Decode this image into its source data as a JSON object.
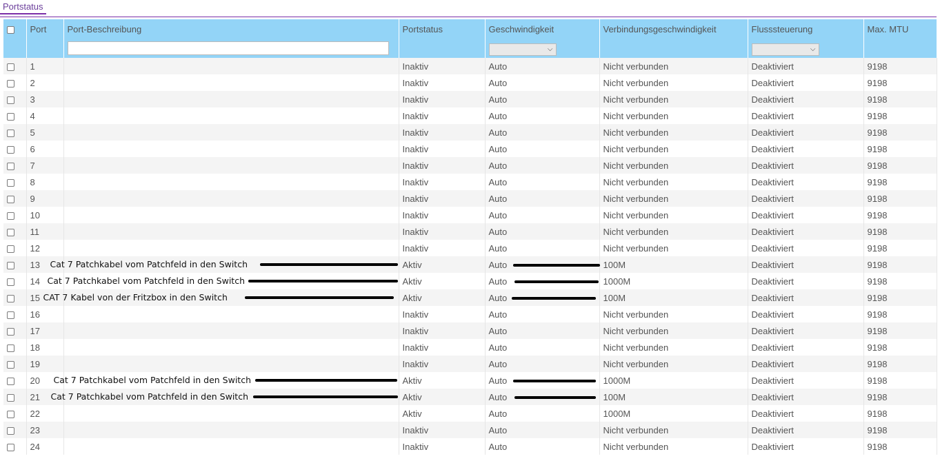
{
  "tab": {
    "label": "Portstatus"
  },
  "columns": [
    "Port",
    "Port-Beschreibung",
    "Portstatus",
    "Geschwindigkeit",
    "Verbindungsgeschwindigkeit",
    "Flusssteuerung",
    "Max. MTU"
  ],
  "filter": {
    "description_value": "",
    "speed_selected": "",
    "flow_selected": ""
  },
  "rows": [
    {
      "port": "1",
      "desc": "",
      "status": "Inaktiv",
      "speed": "Auto",
      "link": "Nicht verbunden",
      "flow": "Deaktiviert",
      "mtu": "9198"
    },
    {
      "port": "2",
      "desc": "",
      "status": "Inaktiv",
      "speed": "Auto",
      "link": "Nicht verbunden",
      "flow": "Deaktiviert",
      "mtu": "9198"
    },
    {
      "port": "3",
      "desc": "",
      "status": "Inaktiv",
      "speed": "Auto",
      "link": "Nicht verbunden",
      "flow": "Deaktiviert",
      "mtu": "9198"
    },
    {
      "port": "4",
      "desc": "",
      "status": "Inaktiv",
      "speed": "Auto",
      "link": "Nicht verbunden",
      "flow": "Deaktiviert",
      "mtu": "9198"
    },
    {
      "port": "5",
      "desc": "",
      "status": "Inaktiv",
      "speed": "Auto",
      "link": "Nicht verbunden",
      "flow": "Deaktiviert",
      "mtu": "9198"
    },
    {
      "port": "6",
      "desc": "",
      "status": "Inaktiv",
      "speed": "Auto",
      "link": "Nicht verbunden",
      "flow": "Deaktiviert",
      "mtu": "9198"
    },
    {
      "port": "7",
      "desc": "",
      "status": "Inaktiv",
      "speed": "Auto",
      "link": "Nicht verbunden",
      "flow": "Deaktiviert",
      "mtu": "9198"
    },
    {
      "port": "8",
      "desc": "",
      "status": "Inaktiv",
      "speed": "Auto",
      "link": "Nicht verbunden",
      "flow": "Deaktiviert",
      "mtu": "9198"
    },
    {
      "port": "9",
      "desc": "",
      "status": "Inaktiv",
      "speed": "Auto",
      "link": "Nicht verbunden",
      "flow": "Deaktiviert",
      "mtu": "9198"
    },
    {
      "port": "10",
      "desc": "",
      "status": "Inaktiv",
      "speed": "Auto",
      "link": "Nicht verbunden",
      "flow": "Deaktiviert",
      "mtu": "9198"
    },
    {
      "port": "11",
      "desc": "",
      "status": "Inaktiv",
      "speed": "Auto",
      "link": "Nicht verbunden",
      "flow": "Deaktiviert",
      "mtu": "9198"
    },
    {
      "port": "12",
      "desc": "",
      "status": "Inaktiv",
      "speed": "Auto",
      "link": "Nicht verbunden",
      "flow": "Deaktiviert",
      "mtu": "9198"
    },
    {
      "port": "13",
      "desc": "Cat 7 Patchkabel vom Patchfeld in den Switch",
      "status": "Aktiv",
      "speed": "Auto",
      "link": "100M",
      "flow": "Deaktiviert",
      "mtu": "9198"
    },
    {
      "port": "14",
      "desc": "Cat 7 Patchkabel vom Patchfeld in den Switch",
      "status": "Aktiv",
      "speed": "Auto",
      "link": "1000M",
      "flow": "Deaktiviert",
      "mtu": "9198"
    },
    {
      "port": "15",
      "desc": "CAT 7 Kabel von der Fritzbox in den Switch",
      "status": "Aktiv",
      "speed": "Auto",
      "link": "100M",
      "flow": "Deaktiviert",
      "mtu": "9198"
    },
    {
      "port": "16",
      "desc": "",
      "status": "Inaktiv",
      "speed": "Auto",
      "link": "Nicht verbunden",
      "flow": "Deaktiviert",
      "mtu": "9198"
    },
    {
      "port": "17",
      "desc": "",
      "status": "Inaktiv",
      "speed": "Auto",
      "link": "Nicht verbunden",
      "flow": "Deaktiviert",
      "mtu": "9198"
    },
    {
      "port": "18",
      "desc": "",
      "status": "Inaktiv",
      "speed": "Auto",
      "link": "Nicht verbunden",
      "flow": "Deaktiviert",
      "mtu": "9198"
    },
    {
      "port": "19",
      "desc": "",
      "status": "Inaktiv",
      "speed": "Auto",
      "link": "Nicht verbunden",
      "flow": "Deaktiviert",
      "mtu": "9198"
    },
    {
      "port": "20",
      "desc": "Cat 7 Patchkabel vom Patchfeld in den Switch",
      "status": "Aktiv",
      "speed": "Auto",
      "link": "1000M",
      "flow": "Deaktiviert",
      "mtu": "9198"
    },
    {
      "port": "21",
      "desc": "Cat 7 Patchkabel vom Patchfeld in den Switch",
      "status": "Aktiv",
      "speed": "Auto",
      "link": "100M",
      "flow": "Deaktiviert",
      "mtu": "9198"
    },
    {
      "port": "22",
      "desc": "",
      "status": "Aktiv",
      "speed": "Auto",
      "link": "1000M",
      "flow": "Deaktiviert",
      "mtu": "9198"
    },
    {
      "port": "23",
      "desc": "",
      "status": "Inaktiv",
      "speed": "Auto",
      "link": "Nicht verbunden",
      "flow": "Deaktiviert",
      "mtu": "9198"
    },
    {
      "port": "24",
      "desc": "",
      "status": "Inaktiv",
      "speed": "Auto",
      "link": "Nicht verbunden",
      "flow": "Deaktiviert",
      "mtu": "9198"
    }
  ]
}
